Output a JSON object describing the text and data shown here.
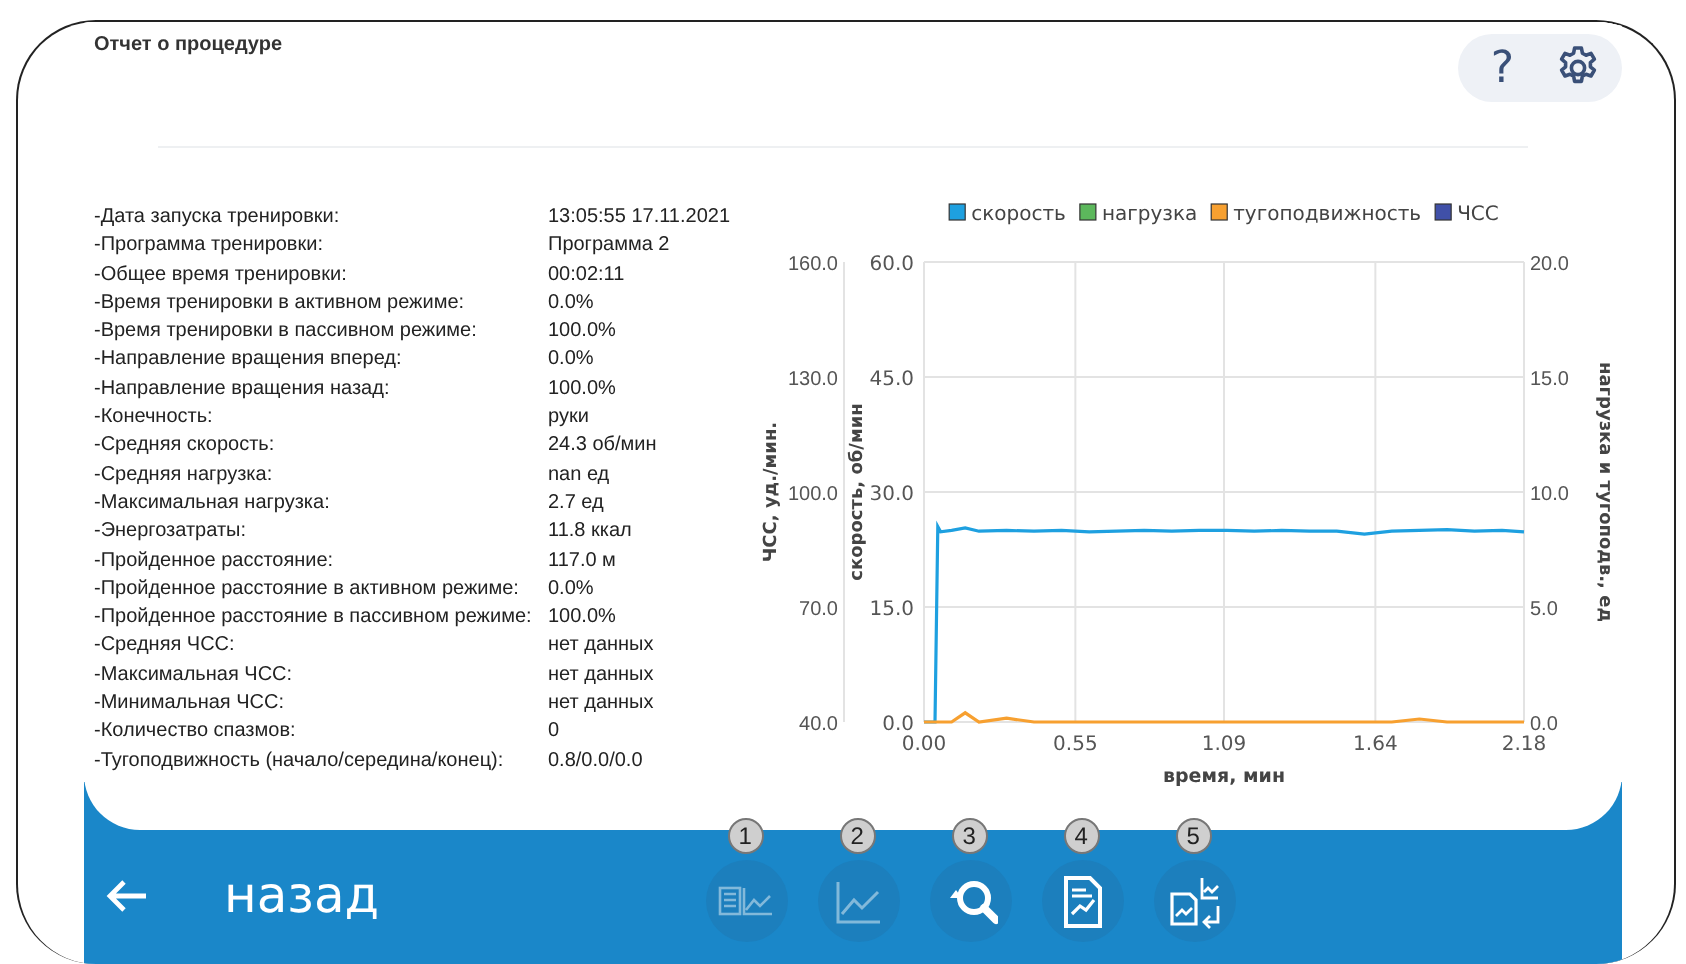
{
  "header": {
    "title": "Отчет о процедуре",
    "help": "?"
  },
  "summary": [
    {
      "label": "-Дата запуска тренировки:",
      "value": "13:05:55 17.11.2021"
    },
    {
      "label": "-Программа тренировки:",
      "value": "Программа 2"
    },
    {
      "label": "-Общее время тренировки:",
      "value": "00:02:11"
    },
    {
      "label": "-Время тренировки в активном режиме:",
      "value": "0.0%"
    },
    {
      "label": "-Время тренировки в пассивном режиме:",
      "value": "100.0%"
    },
    {
      "label": "-Направление вращения вперед:",
      "value": "0.0%"
    },
    {
      "label": "-Направление вращения назад:",
      "value": "100.0%"
    },
    {
      "label": "-Конечность:",
      "value": "руки"
    },
    {
      "label": "-Средняя скорость:",
      "value": "24.3 об/мин"
    },
    {
      "label": "-Средняя нагрузка:",
      "value": "nan ед"
    },
    {
      "label": "-Максимальная нагрузка:",
      "value": "2.7 ед"
    },
    {
      "label": "-Энергозатраты:",
      "value": "11.8 ккал"
    },
    {
      "label": "-Пройденное расстояние:",
      "value": "117.0 м"
    },
    {
      "label": "-Пройденное расстояние в активном режиме:",
      "value": "0.0%"
    },
    {
      "label": "-Пройденное расстояние в пассивном режиме:",
      "value": "100.0%"
    },
    {
      "label": "-Средняя ЧСС:",
      "value": "нет данных"
    },
    {
      "label": "-Максимальная ЧСС:",
      "value": "нет данных"
    },
    {
      "label": "-Минимальная ЧСС:",
      "value": "нет данных"
    },
    {
      "label": "-Количество спазмов:",
      "value": "0"
    },
    {
      "label": "-Тугоподвижность (начало/середина/конец):",
      "value": "0.8/0.0/0.0"
    }
  ],
  "chart": {
    "chart_data": {
      "type": "line",
      "xlabel": "время, мин",
      "ylabel": "скорость, об/мин",
      "x": [
        0,
        0.04,
        0.05,
        0.06,
        0.1,
        0.15,
        0.2,
        0.3,
        0.4,
        0.5,
        0.6,
        0.7,
        0.8,
        0.9,
        1.0,
        1.1,
        1.2,
        1.3,
        1.4,
        1.5,
        1.6,
        1.7,
        1.8,
        1.9,
        2.0,
        2.1,
        2.18
      ],
      "series": [
        {
          "name": "скорость",
          "color": "#1ea0e0",
          "values": [
            0,
            0,
            25.5,
            24.8,
            25,
            25.3,
            24.9,
            25,
            24.9,
            25,
            24.8,
            24.9,
            25,
            24.9,
            25,
            25,
            24.9,
            25,
            24.9,
            24.9,
            24.5,
            24.9,
            25,
            25.1,
            24.9,
            25,
            24.8
          ]
        },
        {
          "name": "нагрузка",
          "color": "#5cb85c",
          "values": [
            null,
            null,
            null,
            null,
            null,
            null,
            null,
            null,
            null,
            null,
            null,
            null,
            null,
            null,
            null,
            null,
            null,
            null,
            null,
            null,
            null,
            null,
            null,
            null,
            null,
            null,
            null
          ]
        },
        {
          "name": "тугоподвижность",
          "color": "#f7a030",
          "values": [
            0,
            0,
            0,
            0,
            0,
            1.2,
            0,
            0.5,
            0,
            0,
            0,
            0,
            0,
            0,
            0,
            0,
            0,
            0,
            0,
            0,
            0,
            0,
            0.4,
            0,
            0,
            0,
            0
          ]
        },
        {
          "name": "ЧСС",
          "color": "#4050a8",
          "values": [
            null,
            null,
            null,
            null,
            null,
            null,
            null,
            null,
            null,
            null,
            null,
            null,
            null,
            null,
            null,
            null,
            null,
            null,
            null,
            null,
            null,
            null,
            null,
            null,
            null,
            null,
            null
          ]
        }
      ],
      "grid": true,
      "legend": true,
      "xlim": [
        0,
        2.18
      ],
      "ylim": [
        0,
        60
      ],
      "xticks": [
        {
          "value": 0,
          "label": "0.00"
        },
        {
          "value": 0.55,
          "label": "0.55"
        },
        {
          "value": 1.09,
          "label": "1.09"
        },
        {
          "value": 1.64,
          "label": "1.64"
        },
        {
          "value": 2.18,
          "label": "2.18"
        }
      ],
      "yticks": [
        {
          "value": 0,
          "label": "0.0"
        },
        {
          "value": 15,
          "label": "15.0"
        },
        {
          "value": 30,
          "label": "30.0"
        },
        {
          "value": 45,
          "label": "45.0"
        },
        {
          "value": 60,
          "label": "60.0"
        }
      ]
    },
    "hr_axis": {
      "title": "ЧСС, уд./мин.",
      "ticks": [
        "160.0",
        "130.0",
        "100.0",
        "70.0",
        "40.0"
      ]
    },
    "right_axis": {
      "title": "нагрузка и тугоподв., ед",
      "ticks": [
        "20.0",
        "15.0",
        "10.0",
        "5.0",
        "0.0"
      ]
    }
  },
  "footer": {
    "back": "назад",
    "tools": [
      {
        "badge": "1",
        "kind": "list-chart",
        "disabled": true
      },
      {
        "badge": "2",
        "kind": "chart",
        "disabled": true
      },
      {
        "badge": "3",
        "kind": "search",
        "disabled": false
      },
      {
        "badge": "4",
        "kind": "document",
        "disabled": false
      },
      {
        "badge": "5",
        "kind": "swap",
        "disabled": false
      }
    ]
  }
}
